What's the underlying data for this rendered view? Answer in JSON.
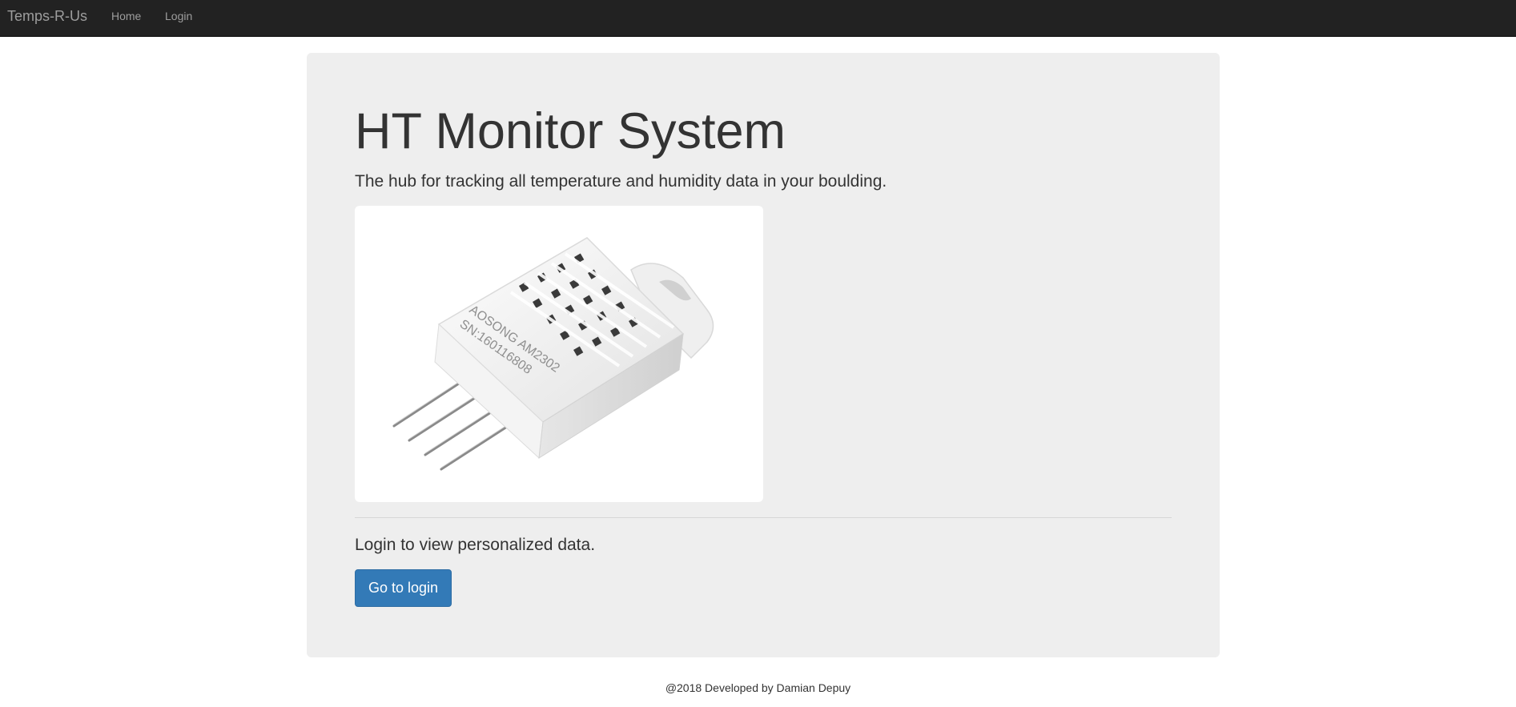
{
  "navbar": {
    "brand": "Temps-R-Us",
    "links": [
      "Home",
      "Login"
    ]
  },
  "hero": {
    "title": "HT Monitor System",
    "lead": "The hub for tracking all temperature and humidity data in your boulding.",
    "image": {
      "label_line1": "AOSONG AM2302",
      "label_line2": "SN:160116808"
    },
    "login_text": "Login to view personalized data.",
    "login_button": "Go to login"
  },
  "footer": {
    "text": "@2018 Developed by Damian Depuy"
  },
  "colors": {
    "navbar_bg": "#222222",
    "nav_text": "#9d9d9d",
    "jumbotron_bg": "#eeeeee",
    "primary_button": "#337ab7"
  }
}
